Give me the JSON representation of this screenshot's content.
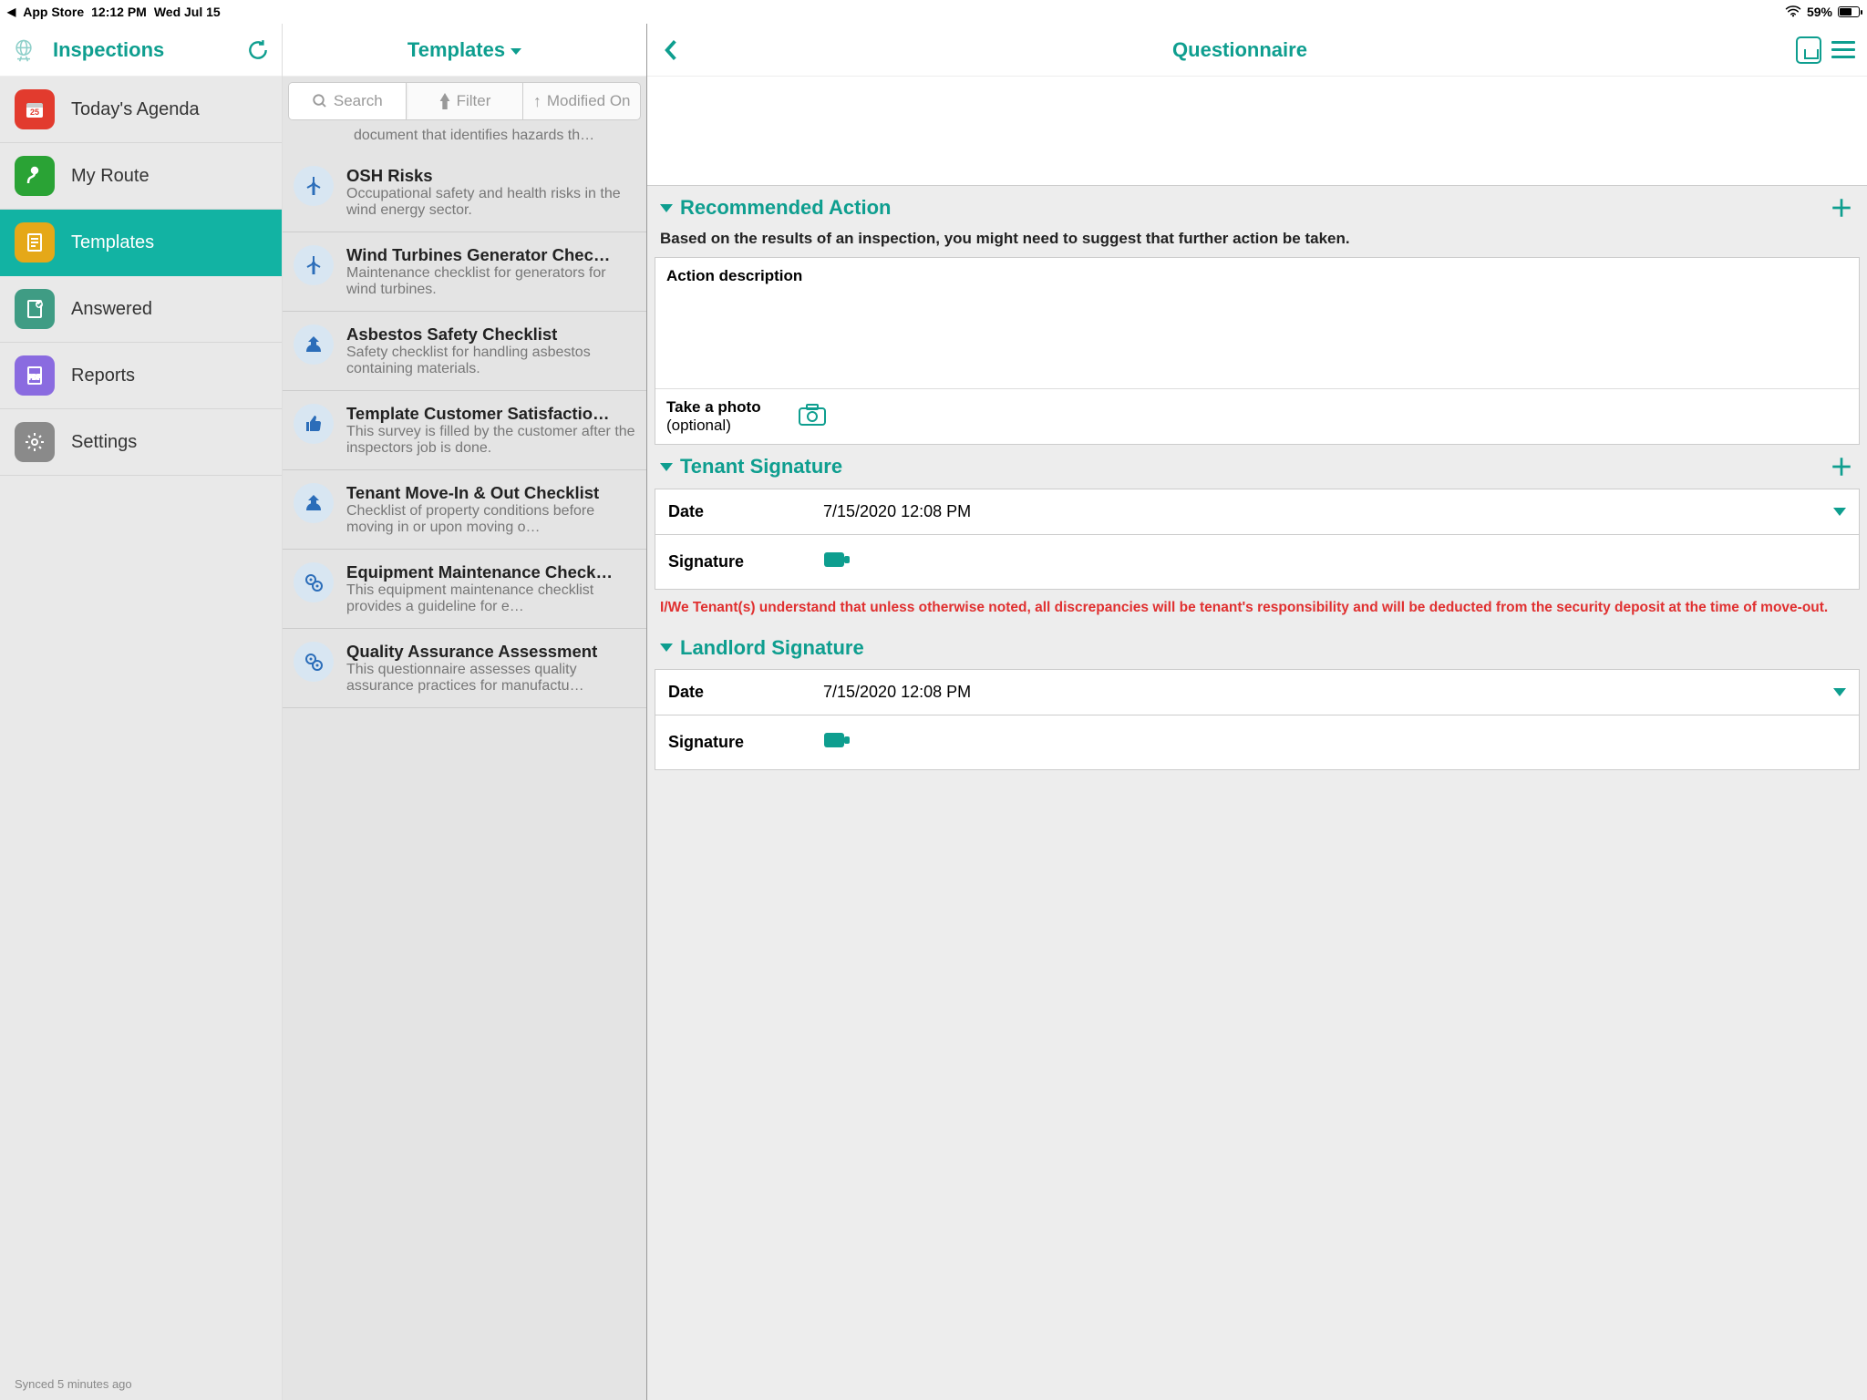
{
  "status": {
    "back_app": "App Store",
    "time": "12:12 PM",
    "date": "Wed Jul 15",
    "battery_pct": "59%"
  },
  "left": {
    "title": "Inspections",
    "items": [
      {
        "label": "Today's Agenda",
        "icon_color": "#e23b2e"
      },
      {
        "label": "My Route",
        "icon_color": "#2aa335"
      },
      {
        "label": "Templates",
        "icon_color": "#e5a818",
        "active": true
      },
      {
        "label": "Answered",
        "icon_color": "#3f9c84"
      },
      {
        "label": "Reports",
        "icon_color": "#8a6be0"
      },
      {
        "label": "Settings",
        "icon_color": "#8a8a8a"
      }
    ],
    "sync_status": "Synced 5 minutes ago"
  },
  "mid": {
    "title": "Templates",
    "toolbar": {
      "search": "Search",
      "filter": "Filter",
      "sort": "Modified On"
    },
    "scrap": "document that identifies hazards th…",
    "templates": [
      {
        "title": "OSH Risks",
        "desc": "Occupational safety and health risks in the wind energy sector.",
        "icon": "wind"
      },
      {
        "title": "Wind Turbines Generator Chec…",
        "desc": "Maintenance checklist for generators for wind turbines.",
        "icon": "wind"
      },
      {
        "title": "Asbestos Safety Checklist",
        "desc": "Safety checklist for handling asbestos containing materials.",
        "icon": "house"
      },
      {
        "title": "Template Customer Satisfactio…",
        "desc": "This survey is filled by the customer after the inspectors job is done.",
        "icon": "thumb"
      },
      {
        "title": "Tenant Move-In & Out Checklist",
        "desc": "Checklist of property conditions before moving in or upon moving o…",
        "icon": "house"
      },
      {
        "title": "Equipment Maintenance Check…",
        "desc": "This equipment maintenance checklist provides a guideline for e…",
        "icon": "gear"
      },
      {
        "title": "Quality Assurance Assessment",
        "desc": "This questionnaire assesses quality assurance practices for manufactu…",
        "icon": "gear"
      }
    ]
  },
  "right": {
    "title": "Questionnaire",
    "sections": {
      "recommended": {
        "header": "Recommended Action",
        "sub": "Based on the results of an inspection, you might need to suggest that further action be taken.",
        "action_label": "Action description",
        "photo_label": "Take a photo",
        "photo_opt": "(optional)"
      },
      "tenant": {
        "header": "Tenant Signature",
        "date_label": "Date",
        "date_value": "7/15/2020 12:08 PM",
        "sig_label": "Signature",
        "disclaimer": "I/We Tenant(s) understand that unless otherwise  noted, all discrepancies will be tenant's responsibility and will be deducted from the security deposit  at the time of move-out."
      },
      "landlord": {
        "header": "Landlord Signature",
        "date_label": "Date",
        "date_value": "7/15/2020 12:08 PM",
        "sig_label": "Signature"
      }
    }
  }
}
